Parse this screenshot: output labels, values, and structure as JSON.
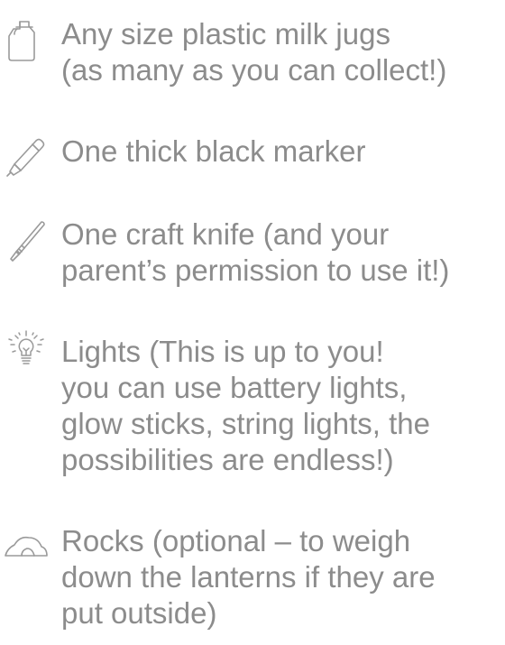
{
  "items": [
    {
      "icon": "milk-jug-icon",
      "lines": [
        "Any size plastic milk jugs",
        "(as many as you can collect!)"
      ]
    },
    {
      "icon": "marker-icon",
      "lines": [
        "One thick black marker"
      ]
    },
    {
      "icon": "craft-knife-icon",
      "lines": [
        "One craft knife (and your",
        "parent’s permission to use it!)"
      ]
    },
    {
      "icon": "light-bulb-icon",
      "lines": [
        "Lights (This is up to you!",
        "you can use battery lights,",
        "glow sticks, string lights, the",
        "possibilities are endless!)"
      ]
    },
    {
      "icon": "rocks-icon",
      "lines": [
        "Rocks (optional – to weigh",
        "down the lanterns if they are",
        "put outside)"
      ]
    }
  ],
  "colors": {
    "text": "#8c8c8c",
    "icon_stroke": "#9a9a9a"
  }
}
